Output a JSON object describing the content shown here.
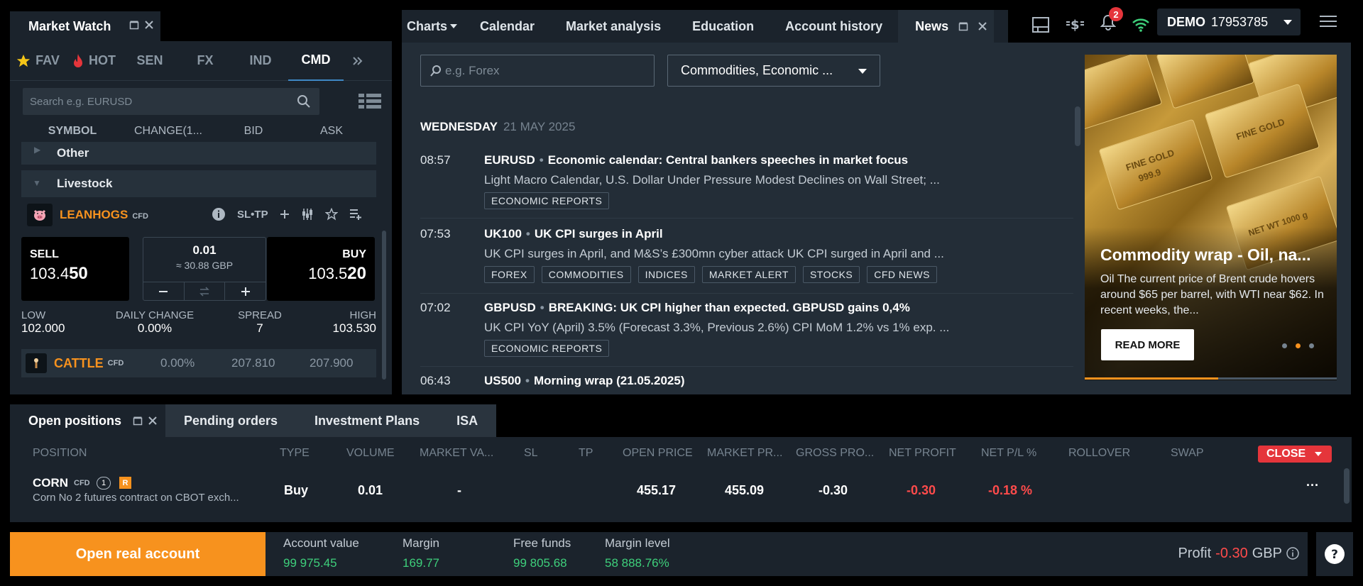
{
  "market_watch": {
    "title": "Market Watch",
    "tabs": [
      {
        "label": "FAV",
        "icon": "star-icon"
      },
      {
        "label": "HOT",
        "icon": "flame-icon"
      },
      {
        "label": "SEN"
      },
      {
        "label": "FX"
      },
      {
        "label": "IND"
      },
      {
        "label": "CMD",
        "active": true
      }
    ],
    "search_placeholder": "Search e.g. EURUSD",
    "columns": [
      "SYMBOL",
      "CHANGE(1...",
      "BID",
      "ASK"
    ],
    "groups": {
      "other": "Other",
      "livestock": "Livestock"
    },
    "instrument": {
      "symbol": "LEANHOGS",
      "type": "CFD",
      "sltp": "SL•TP",
      "sell_label": "SELL",
      "sell_price_main": "103.4",
      "sell_price_big": "50",
      "buy_label": "BUY",
      "buy_price_main": "103.5",
      "buy_price_big": "20",
      "volume": "0.01",
      "volume_value": "≈ 30.88 GBP",
      "low_label": "LOW",
      "low": "102.000",
      "change_label": "DAILY CHANGE",
      "change": "0.00%",
      "spread_label": "SPREAD",
      "spread": "7",
      "high_label": "HIGH",
      "high": "103.530"
    },
    "cattle": {
      "symbol": "CATTLE",
      "type": "CFD",
      "change": "0.00%",
      "bid": "207.810",
      "ask": "207.900"
    }
  },
  "news_tabs": [
    {
      "label": "Charts"
    },
    {
      "label": "Calendar"
    },
    {
      "label": "Market analysis"
    },
    {
      "label": "Education"
    },
    {
      "label": "Account history"
    },
    {
      "label": "News",
      "active": true
    }
  ],
  "news": {
    "search_placeholder": "e.g. Forex",
    "filter_value": "Commodities, Economic ...",
    "day": "WEDNESDAY",
    "date": "21 MAY 2025",
    "items": [
      {
        "time": "08:57",
        "symbol": "EURUSD",
        "title": "Economic calendar: Central bankers speeches in market focus",
        "body": "Light Macro Calendar, U.S. Dollar Under Pressure Modest Declines on Wall Street; ...",
        "tags": [
          "ECONOMIC REPORTS"
        ]
      },
      {
        "time": "07:53",
        "symbol": "UK100",
        "title": "UK CPI surges in April",
        "body": "UK CPI surges in April, and M&S’s £300mn cyber attack UK CPI surged in April and ...",
        "tags": [
          "FOREX",
          "COMMODITIES",
          "INDICES",
          "MARKET ALERT",
          "STOCKS",
          "CFD NEWS"
        ]
      },
      {
        "time": "07:02",
        "symbol": "GBPUSD",
        "title": "BREAKING: UK CPI higher than expected. GBPUSD gains 0,4%",
        "body": "UK CPI YoY (April) 3.5% (Forecast 3.3%, Previous 2.6%) CPI MoM 1.2% vs 1% exp. ...",
        "tags": [
          "ECONOMIC REPORTS"
        ]
      },
      {
        "time": "06:43",
        "symbol": "US500",
        "title": "Morning wrap (21.05.2025)",
        "body": "",
        "tags": []
      }
    ],
    "banner": {
      "title": "Commodity wrap - Oil, na...",
      "text": "Oil The current price of Brent crude hovers around $65 per barrel, with WTI near $62. In recent weeks, the...",
      "button": "READ MORE",
      "bar_labels": [
        "FINE GOLD",
        "999.9",
        "FINE GOLD",
        "NET WT 1000 g"
      ]
    }
  },
  "topbar": {
    "notification_count": "2",
    "account_type": "DEMO",
    "account_number": "17953785"
  },
  "positions": {
    "tabs": [
      {
        "label": "Open positions",
        "active": true
      },
      {
        "label": "Pending orders"
      },
      {
        "label": "Investment Plans"
      },
      {
        "label": "ISA"
      }
    ],
    "columns": [
      "POSITION",
      "TYPE",
      "VOLUME",
      "MARKET VA...",
      "SL",
      "TP",
      "OPEN PRICE",
      "MARKET PR...",
      "GROSS PRO...",
      "NET PROFIT",
      "NET P/L %",
      "ROLLOVER",
      "SWAP"
    ],
    "close_label": "CLOSE",
    "rows": [
      {
        "symbol": "CORN",
        "type_tag": "CFD",
        "count": "1",
        "badge": "R",
        "description": "Corn No 2 futures contract on CBOT exch...",
        "side": "Buy",
        "volume": "0.01",
        "market_value": "-",
        "open_price": "455.17",
        "market_price": "455.09",
        "gross_profit": "-0.30",
        "net_profit": "-0.30",
        "net_pl": "-0.18 %",
        "more": "···"
      }
    ]
  },
  "footer": {
    "open_real": "Open real account",
    "stats": [
      {
        "label": "Account value",
        "value": "99 975.45"
      },
      {
        "label": "Margin",
        "value": "169.77"
      },
      {
        "label": "Free funds",
        "value": "99 805.68"
      },
      {
        "label": "Margin level",
        "value": "58 888.76%"
      }
    ],
    "profit_label": "Profit",
    "profit_value": "-0.30",
    "currency": "GBP"
  },
  "colors": {
    "accent": "#3f88c5",
    "orange": "#f7921e",
    "positive": "#3ecf7b",
    "negative": "#ff4b4b",
    "close": "#e5353b"
  }
}
